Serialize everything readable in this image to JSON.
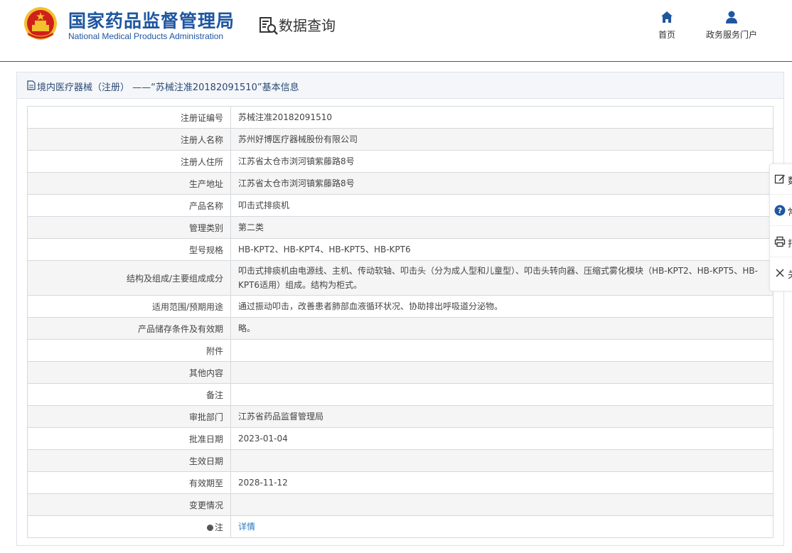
{
  "header": {
    "logo_cn": "国家药品监督管理局",
    "logo_en": "National Medical Products Administration",
    "data_query": "数据查询",
    "nav": [
      {
        "label": "首页",
        "icon": "home-icon"
      },
      {
        "label": "政务服务门户",
        "icon": "user-icon"
      }
    ]
  },
  "panel": {
    "title": "境内医疗器械（注册） ——“苏械注准20182091510”基本信息"
  },
  "rows": [
    {
      "key": "注册证编号",
      "value": "苏械注准20182091510"
    },
    {
      "key": "注册人名称",
      "value": "苏州好博医疗器械股份有限公司"
    },
    {
      "key": "注册人住所",
      "value": "江苏省太仓市浏河镇紫藤路8号"
    },
    {
      "key": "生产地址",
      "value": "江苏省太仓市浏河镇紫藤路8号"
    },
    {
      "key": "产品名称",
      "value": "叩击式排痰机"
    },
    {
      "key": "管理类别",
      "value": "第二类"
    },
    {
      "key": "型号规格",
      "value": "HB-KPT2、HB-KPT4、HB-KPT5、HB-KPT6"
    },
    {
      "key": "结构及组成/主要组成成分",
      "value": "叩击式排痰机由电源线、主机、传动软轴、叩击头（分为成人型和儿童型）、叩击头转向器、压缩式雾化模块（HB-KPT2、HB-KPT5、HB-KPT6适用）组成。结构为柜式。"
    },
    {
      "key": "适用范围/预期用途",
      "value": "通过振动叩击，改善患者肺部血液循环状况、协助排出呼吸道分泌物。"
    },
    {
      "key": "产品储存条件及有效期",
      "value": "略。"
    },
    {
      "key": "附件",
      "value": ""
    },
    {
      "key": "其他内容",
      "value": ""
    },
    {
      "key": "备注",
      "value": ""
    },
    {
      "key": "审批部门",
      "value": "江苏省药品监督管理局"
    },
    {
      "key": "批准日期",
      "value": "2023-01-04"
    },
    {
      "key": "生效日期",
      "value": ""
    },
    {
      "key": "有效期至",
      "value": "2028-11-12"
    },
    {
      "key": "变更情况",
      "value": ""
    },
    {
      "key": "注",
      "value": "详情"
    }
  ],
  "sidebar": [
    {
      "label": "数",
      "icon": "edit-icon"
    },
    {
      "label": "常",
      "icon": "help-icon"
    },
    {
      "label": "打",
      "icon": "print-icon"
    },
    {
      "label": "关",
      "icon": "close-icon"
    }
  ],
  "colors": {
    "brand_blue": "#1e56a0",
    "link": "#2a78c4",
    "emblem_red": "#d0201a",
    "emblem_gold": "#f2c12e"
  }
}
